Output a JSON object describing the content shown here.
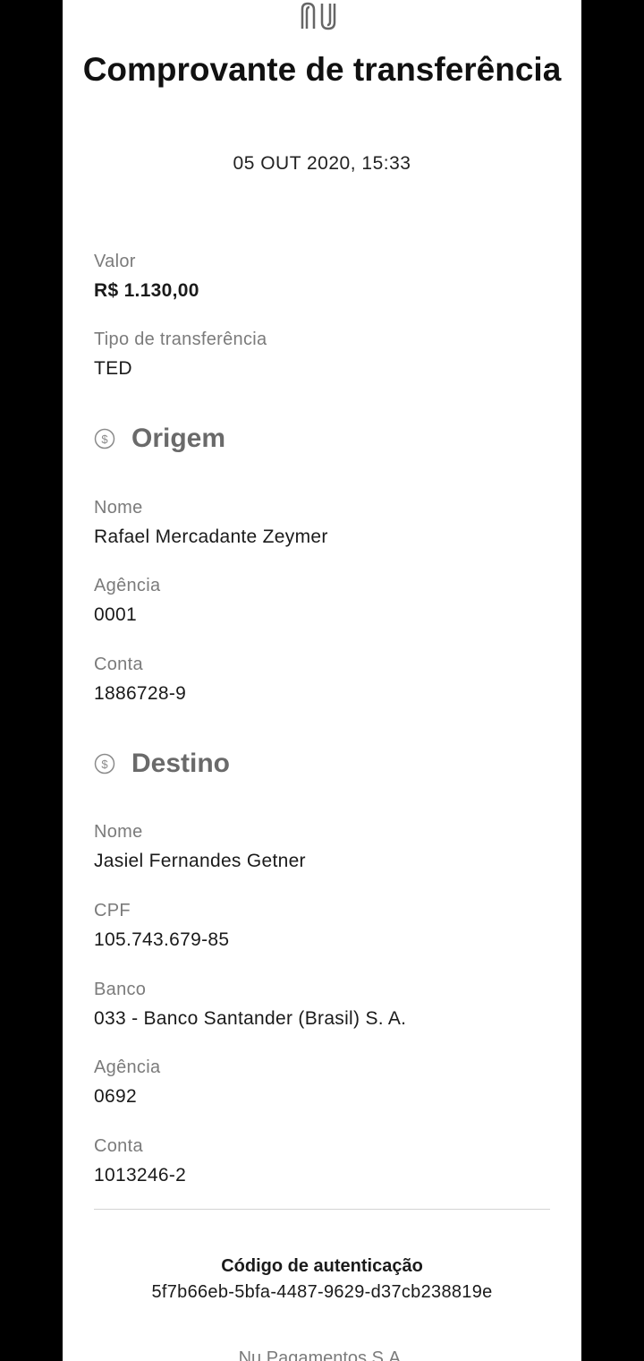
{
  "colors": {
    "background": "#000000",
    "card": "#ffffff",
    "label": "#7b7b7b",
    "value": "#1a1a1a",
    "section_heading": "#6a6a6a",
    "divider": "#d4d4d4"
  },
  "header": {
    "logo_icon": "nubank-logo-icon",
    "title": "Comprovante de transferência",
    "timestamp": "05 OUT 2020, 15:33"
  },
  "summary": {
    "amount_label": "Valor",
    "amount_value": "R$ 1.130,00",
    "type_label": "Tipo de transferência",
    "type_value": "TED"
  },
  "origin": {
    "icon": "dollar-circle-icon",
    "title": "Origem",
    "name_label": "Nome",
    "name_value": "Rafael Mercadante Zeymer",
    "branch_label": "Agência",
    "branch_value": "0001",
    "account_label": "Conta",
    "account_value": "1886728-9"
  },
  "destination": {
    "icon": "dollar-circle-icon",
    "title": "Destino",
    "name_label": "Nome",
    "name_value": "Jasiel Fernandes Getner",
    "cpf_label": "CPF",
    "cpf_value": "105.743.679-85",
    "bank_label": "Banco",
    "bank_value": "033 - Banco Santander (Brasil) S. A.",
    "branch_label": "Agência",
    "branch_value": "0692",
    "account_label": "Conta",
    "account_value": "1013246-2"
  },
  "authentication": {
    "title": "Código de autenticação",
    "code": "5f7b66eb-5bfa-4487-9629-d37cb238819e"
  },
  "footer": {
    "company": "Nu Pagamentos S.A."
  }
}
